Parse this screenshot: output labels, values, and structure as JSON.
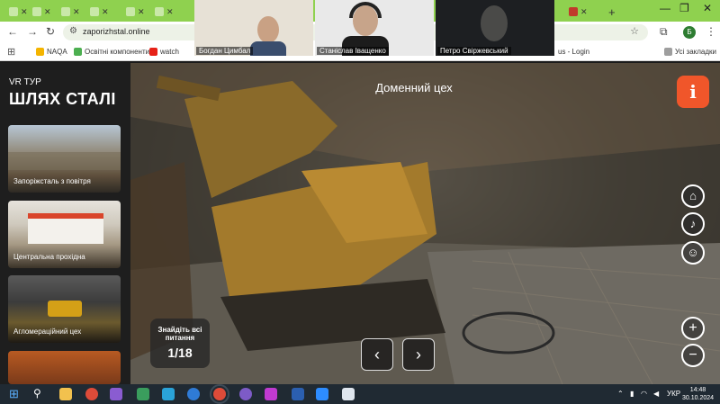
{
  "browser": {
    "url": "zaporizhstal.online",
    "bookmarks": [
      {
        "label": "NAQA",
        "color": "#f4b400"
      },
      {
        "label": "Освітні компоненти",
        "color": "#4caf50"
      },
      {
        "label": "watch",
        "color": "#e62117"
      },
      {
        "label": "us - Login",
        "color": "#7b7b7b"
      },
      {
        "label": "Усі закладки",
        "color": "#9e9e9e"
      }
    ],
    "profile_initial": "Б",
    "window_controls": [
      "—",
      "❐",
      "✕"
    ]
  },
  "video_call": {
    "participants": [
      {
        "name": "Богдан Цимбал",
        "bg": "#e7e1d6"
      },
      {
        "name": "Станіслав Іващенко",
        "bg": "#e9e9e9"
      },
      {
        "name": "Петро Свіржевський",
        "bg": "#1d1f22"
      }
    ]
  },
  "sidebar": {
    "vr_label": "VR ТУР",
    "title": "ШЛЯХ СТАЛІ",
    "locations": [
      {
        "caption": "Запоріжсталь з повітря"
      },
      {
        "caption": "Центральна прохідна"
      },
      {
        "caption": "Агломераційний цех"
      },
      {
        "caption": ""
      }
    ]
  },
  "scene": {
    "title": "Доменний цех",
    "info_button": "i",
    "quiz_label": "Знайдіть всі питання",
    "quiz_progress": "1/18",
    "zoom_in": "+",
    "zoom_out": "−",
    "prev": "‹",
    "next": "›"
  },
  "taskbar": {
    "language": "УКР",
    "time": "14:48",
    "date": "30.10.2024"
  },
  "colors": {
    "tab_bar": "#8fd14f",
    "accent": "#f0562a",
    "sidebar": "#1e1e1e",
    "taskbar": "#202a33"
  }
}
